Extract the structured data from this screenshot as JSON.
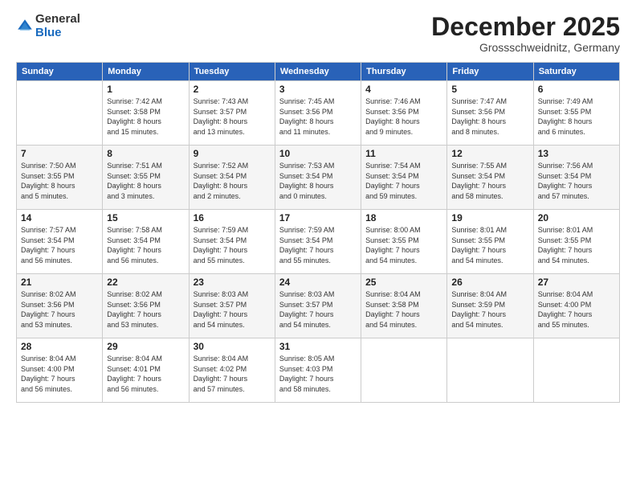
{
  "logo": {
    "general": "General",
    "blue": "Blue"
  },
  "header": {
    "month": "December 2025",
    "location": "Grossschweidnitz, Germany"
  },
  "weekdays": [
    "Sunday",
    "Monday",
    "Tuesday",
    "Wednesday",
    "Thursday",
    "Friday",
    "Saturday"
  ],
  "weeks": [
    [
      {
        "day": "",
        "info": ""
      },
      {
        "day": "1",
        "info": "Sunrise: 7:42 AM\nSunset: 3:58 PM\nDaylight: 8 hours\nand 15 minutes."
      },
      {
        "day": "2",
        "info": "Sunrise: 7:43 AM\nSunset: 3:57 PM\nDaylight: 8 hours\nand 13 minutes."
      },
      {
        "day": "3",
        "info": "Sunrise: 7:45 AM\nSunset: 3:56 PM\nDaylight: 8 hours\nand 11 minutes."
      },
      {
        "day": "4",
        "info": "Sunrise: 7:46 AM\nSunset: 3:56 PM\nDaylight: 8 hours\nand 9 minutes."
      },
      {
        "day": "5",
        "info": "Sunrise: 7:47 AM\nSunset: 3:56 PM\nDaylight: 8 hours\nand 8 minutes."
      },
      {
        "day": "6",
        "info": "Sunrise: 7:49 AM\nSunset: 3:55 PM\nDaylight: 8 hours\nand 6 minutes."
      }
    ],
    [
      {
        "day": "7",
        "info": "Sunrise: 7:50 AM\nSunset: 3:55 PM\nDaylight: 8 hours\nand 5 minutes."
      },
      {
        "day": "8",
        "info": "Sunrise: 7:51 AM\nSunset: 3:55 PM\nDaylight: 8 hours\nand 3 minutes."
      },
      {
        "day": "9",
        "info": "Sunrise: 7:52 AM\nSunset: 3:54 PM\nDaylight: 8 hours\nand 2 minutes."
      },
      {
        "day": "10",
        "info": "Sunrise: 7:53 AM\nSunset: 3:54 PM\nDaylight: 8 hours\nand 0 minutes."
      },
      {
        "day": "11",
        "info": "Sunrise: 7:54 AM\nSunset: 3:54 PM\nDaylight: 7 hours\nand 59 minutes."
      },
      {
        "day": "12",
        "info": "Sunrise: 7:55 AM\nSunset: 3:54 PM\nDaylight: 7 hours\nand 58 minutes."
      },
      {
        "day": "13",
        "info": "Sunrise: 7:56 AM\nSunset: 3:54 PM\nDaylight: 7 hours\nand 57 minutes."
      }
    ],
    [
      {
        "day": "14",
        "info": "Sunrise: 7:57 AM\nSunset: 3:54 PM\nDaylight: 7 hours\nand 56 minutes."
      },
      {
        "day": "15",
        "info": "Sunrise: 7:58 AM\nSunset: 3:54 PM\nDaylight: 7 hours\nand 56 minutes."
      },
      {
        "day": "16",
        "info": "Sunrise: 7:59 AM\nSunset: 3:54 PM\nDaylight: 7 hours\nand 55 minutes."
      },
      {
        "day": "17",
        "info": "Sunrise: 7:59 AM\nSunset: 3:54 PM\nDaylight: 7 hours\nand 55 minutes."
      },
      {
        "day": "18",
        "info": "Sunrise: 8:00 AM\nSunset: 3:55 PM\nDaylight: 7 hours\nand 54 minutes."
      },
      {
        "day": "19",
        "info": "Sunrise: 8:01 AM\nSunset: 3:55 PM\nDaylight: 7 hours\nand 54 minutes."
      },
      {
        "day": "20",
        "info": "Sunrise: 8:01 AM\nSunset: 3:55 PM\nDaylight: 7 hours\nand 54 minutes."
      }
    ],
    [
      {
        "day": "21",
        "info": "Sunrise: 8:02 AM\nSunset: 3:56 PM\nDaylight: 7 hours\nand 53 minutes."
      },
      {
        "day": "22",
        "info": "Sunrise: 8:02 AM\nSunset: 3:56 PM\nDaylight: 7 hours\nand 53 minutes."
      },
      {
        "day": "23",
        "info": "Sunrise: 8:03 AM\nSunset: 3:57 PM\nDaylight: 7 hours\nand 54 minutes."
      },
      {
        "day": "24",
        "info": "Sunrise: 8:03 AM\nSunset: 3:57 PM\nDaylight: 7 hours\nand 54 minutes."
      },
      {
        "day": "25",
        "info": "Sunrise: 8:04 AM\nSunset: 3:58 PM\nDaylight: 7 hours\nand 54 minutes."
      },
      {
        "day": "26",
        "info": "Sunrise: 8:04 AM\nSunset: 3:59 PM\nDaylight: 7 hours\nand 54 minutes."
      },
      {
        "day": "27",
        "info": "Sunrise: 8:04 AM\nSunset: 4:00 PM\nDaylight: 7 hours\nand 55 minutes."
      }
    ],
    [
      {
        "day": "28",
        "info": "Sunrise: 8:04 AM\nSunset: 4:00 PM\nDaylight: 7 hours\nand 56 minutes."
      },
      {
        "day": "29",
        "info": "Sunrise: 8:04 AM\nSunset: 4:01 PM\nDaylight: 7 hours\nand 56 minutes."
      },
      {
        "day": "30",
        "info": "Sunrise: 8:04 AM\nSunset: 4:02 PM\nDaylight: 7 hours\nand 57 minutes."
      },
      {
        "day": "31",
        "info": "Sunrise: 8:05 AM\nSunset: 4:03 PM\nDaylight: 7 hours\nand 58 minutes."
      },
      {
        "day": "",
        "info": ""
      },
      {
        "day": "",
        "info": ""
      },
      {
        "day": "",
        "info": ""
      }
    ]
  ]
}
